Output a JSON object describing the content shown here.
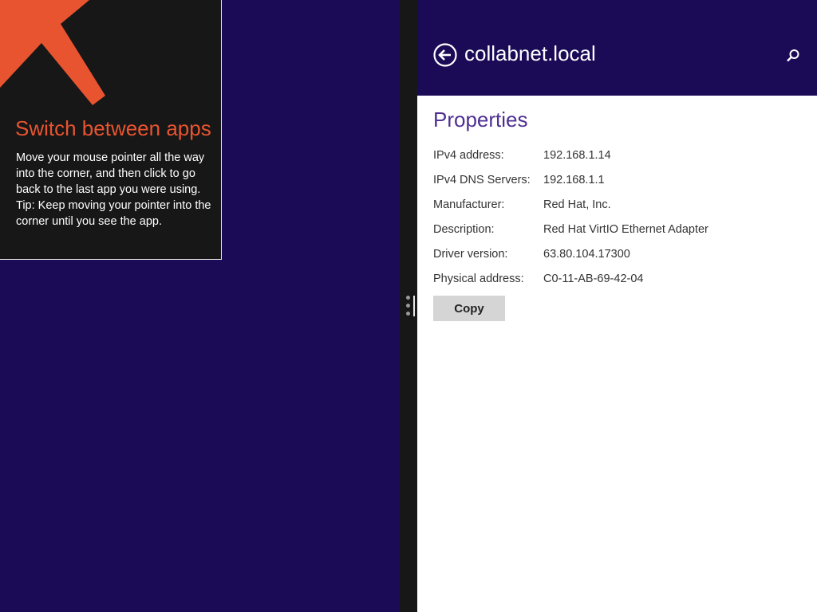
{
  "tip": {
    "title": "Switch between apps",
    "body": "Move your mouse pointer all the way into the corner, and then click to go back to the last app you were using.",
    "tip_line": "Tip: Keep moving your pointer into the corner until you see the app."
  },
  "header": {
    "title": "collabnet.local",
    "back_icon": "back-arrow-circle-icon",
    "search_icon": "search-icon"
  },
  "properties": {
    "title": "Properties",
    "rows": [
      {
        "label": "IPv4 address:",
        "value": "192.168.1.14"
      },
      {
        "label": "IPv4 DNS Servers:",
        "value": "192.168.1.1"
      },
      {
        "label": "Manufacturer:",
        "value": "Red Hat, Inc."
      },
      {
        "label": "Description:",
        "value": "Red Hat VirtIO Ethernet Adapter"
      },
      {
        "label": "Driver version:",
        "value": "63.80.104.17300"
      },
      {
        "label": "Physical address:",
        "value": "C0-11-AB-69-42-04"
      }
    ],
    "copy_label": "Copy"
  },
  "colors": {
    "background": "#1b0a56",
    "tip_accent": "#e8542f",
    "section_title": "#4f2f93"
  }
}
